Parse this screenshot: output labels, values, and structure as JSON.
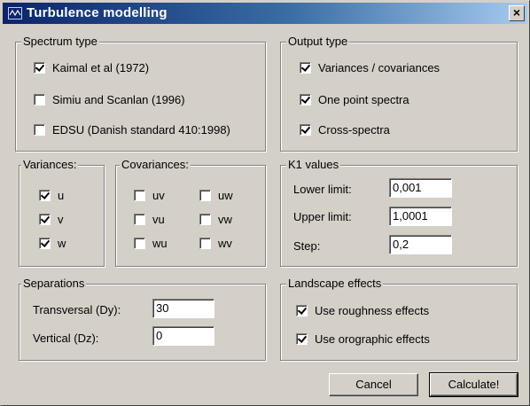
{
  "window": {
    "title": "Turbulence modelling",
    "close_label": "×"
  },
  "spectrum_type": {
    "title": "Spectrum type",
    "options": [
      {
        "label": "Kaimal et al (1972)",
        "checked": true
      },
      {
        "label": "Simiu and Scanlan (1996)",
        "checked": false
      },
      {
        "label": "EDSU (Danish standard 410:1998)",
        "checked": false
      }
    ]
  },
  "output_type": {
    "title": "Output type",
    "options": [
      {
        "label": "Variances / covariances",
        "checked": true
      },
      {
        "label": "One point spectra",
        "checked": true
      },
      {
        "label": "Cross-spectra",
        "checked": true
      }
    ]
  },
  "variances": {
    "title": "Variances:",
    "options": [
      {
        "label": "u",
        "checked": true
      },
      {
        "label": "v",
        "checked": true
      },
      {
        "label": "w",
        "checked": true
      }
    ]
  },
  "covariances": {
    "title": "Covariances:",
    "options": [
      {
        "label": "uv",
        "checked": false
      },
      {
        "label": "uw",
        "checked": false
      },
      {
        "label": "vu",
        "checked": false
      },
      {
        "label": "vw",
        "checked": false
      },
      {
        "label": "wu",
        "checked": false
      },
      {
        "label": "wv",
        "checked": false
      }
    ]
  },
  "k1_values": {
    "title": "K1 values",
    "lower_label": "Lower limit:",
    "lower_value": "0,001",
    "upper_label": "Upper limit:",
    "upper_value": "1,0001",
    "step_label": "Step:",
    "step_value": "0,2"
  },
  "separations": {
    "title": "Separations",
    "transversal_label": "Transversal (Dy):",
    "transversal_value": "30",
    "vertical_label": "Vertical (Dz):",
    "vertical_value": "0"
  },
  "landscape": {
    "title": "Landscape effects",
    "options": [
      {
        "label": "Use roughness effects",
        "checked": true
      },
      {
        "label": "Use orographic effects",
        "checked": true
      }
    ]
  },
  "buttons": {
    "cancel": "Cancel",
    "calculate": "Calculate!"
  }
}
